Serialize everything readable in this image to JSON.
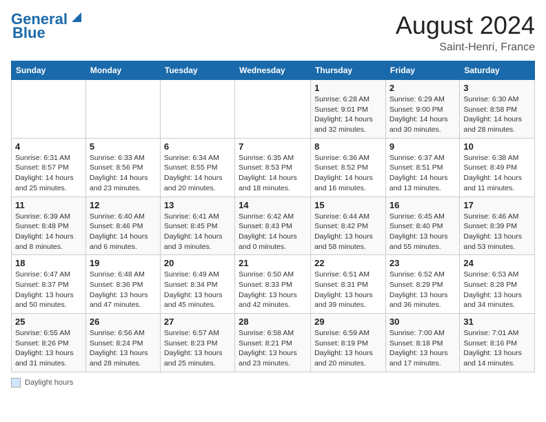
{
  "header": {
    "logo_line1": "General",
    "logo_line2": "Blue",
    "month_year": "August 2024",
    "location": "Saint-Henri, France"
  },
  "weekdays": [
    "Sunday",
    "Monday",
    "Tuesday",
    "Wednesday",
    "Thursday",
    "Friday",
    "Saturday"
  ],
  "weeks": [
    [
      {
        "num": "",
        "detail": ""
      },
      {
        "num": "",
        "detail": ""
      },
      {
        "num": "",
        "detail": ""
      },
      {
        "num": "",
        "detail": ""
      },
      {
        "num": "1",
        "detail": "Sunrise: 6:28 AM\nSunset: 9:01 PM\nDaylight: 14 hours and 32 minutes."
      },
      {
        "num": "2",
        "detail": "Sunrise: 6:29 AM\nSunset: 9:00 PM\nDaylight: 14 hours and 30 minutes."
      },
      {
        "num": "3",
        "detail": "Sunrise: 6:30 AM\nSunset: 8:58 PM\nDaylight: 14 hours and 28 minutes."
      }
    ],
    [
      {
        "num": "4",
        "detail": "Sunrise: 6:31 AM\nSunset: 8:57 PM\nDaylight: 14 hours and 25 minutes."
      },
      {
        "num": "5",
        "detail": "Sunrise: 6:33 AM\nSunset: 8:56 PM\nDaylight: 14 hours and 23 minutes."
      },
      {
        "num": "6",
        "detail": "Sunrise: 6:34 AM\nSunset: 8:55 PM\nDaylight: 14 hours and 20 minutes."
      },
      {
        "num": "7",
        "detail": "Sunrise: 6:35 AM\nSunset: 8:53 PM\nDaylight: 14 hours and 18 minutes."
      },
      {
        "num": "8",
        "detail": "Sunrise: 6:36 AM\nSunset: 8:52 PM\nDaylight: 14 hours and 16 minutes."
      },
      {
        "num": "9",
        "detail": "Sunrise: 6:37 AM\nSunset: 8:51 PM\nDaylight: 14 hours and 13 minutes."
      },
      {
        "num": "10",
        "detail": "Sunrise: 6:38 AM\nSunset: 8:49 PM\nDaylight: 14 hours and 11 minutes."
      }
    ],
    [
      {
        "num": "11",
        "detail": "Sunrise: 6:39 AM\nSunset: 8:48 PM\nDaylight: 14 hours and 8 minutes."
      },
      {
        "num": "12",
        "detail": "Sunrise: 6:40 AM\nSunset: 8:46 PM\nDaylight: 14 hours and 6 minutes."
      },
      {
        "num": "13",
        "detail": "Sunrise: 6:41 AM\nSunset: 8:45 PM\nDaylight: 14 hours and 3 minutes."
      },
      {
        "num": "14",
        "detail": "Sunrise: 6:42 AM\nSunset: 8:43 PM\nDaylight: 14 hours and 0 minutes."
      },
      {
        "num": "15",
        "detail": "Sunrise: 6:44 AM\nSunset: 8:42 PM\nDaylight: 13 hours and 58 minutes."
      },
      {
        "num": "16",
        "detail": "Sunrise: 6:45 AM\nSunset: 8:40 PM\nDaylight: 13 hours and 55 minutes."
      },
      {
        "num": "17",
        "detail": "Sunrise: 6:46 AM\nSunset: 8:39 PM\nDaylight: 13 hours and 53 minutes."
      }
    ],
    [
      {
        "num": "18",
        "detail": "Sunrise: 6:47 AM\nSunset: 8:37 PM\nDaylight: 13 hours and 50 minutes."
      },
      {
        "num": "19",
        "detail": "Sunrise: 6:48 AM\nSunset: 8:36 PM\nDaylight: 13 hours and 47 minutes."
      },
      {
        "num": "20",
        "detail": "Sunrise: 6:49 AM\nSunset: 8:34 PM\nDaylight: 13 hours and 45 minutes."
      },
      {
        "num": "21",
        "detail": "Sunrise: 6:50 AM\nSunset: 8:33 PM\nDaylight: 13 hours and 42 minutes."
      },
      {
        "num": "22",
        "detail": "Sunrise: 6:51 AM\nSunset: 8:31 PM\nDaylight: 13 hours and 39 minutes."
      },
      {
        "num": "23",
        "detail": "Sunrise: 6:52 AM\nSunset: 8:29 PM\nDaylight: 13 hours and 36 minutes."
      },
      {
        "num": "24",
        "detail": "Sunrise: 6:53 AM\nSunset: 8:28 PM\nDaylight: 13 hours and 34 minutes."
      }
    ],
    [
      {
        "num": "25",
        "detail": "Sunrise: 6:55 AM\nSunset: 8:26 PM\nDaylight: 13 hours and 31 minutes."
      },
      {
        "num": "26",
        "detail": "Sunrise: 6:56 AM\nSunset: 8:24 PM\nDaylight: 13 hours and 28 minutes."
      },
      {
        "num": "27",
        "detail": "Sunrise: 6:57 AM\nSunset: 8:23 PM\nDaylight: 13 hours and 25 minutes."
      },
      {
        "num": "28",
        "detail": "Sunrise: 6:58 AM\nSunset: 8:21 PM\nDaylight: 13 hours and 23 minutes."
      },
      {
        "num": "29",
        "detail": "Sunrise: 6:59 AM\nSunset: 8:19 PM\nDaylight: 13 hours and 20 minutes."
      },
      {
        "num": "30",
        "detail": "Sunrise: 7:00 AM\nSunset: 8:18 PM\nDaylight: 13 hours and 17 minutes."
      },
      {
        "num": "31",
        "detail": "Sunrise: 7:01 AM\nSunset: 8:16 PM\nDaylight: 13 hours and 14 minutes."
      }
    ]
  ],
  "footer": {
    "box_label": "Daylight hours"
  }
}
